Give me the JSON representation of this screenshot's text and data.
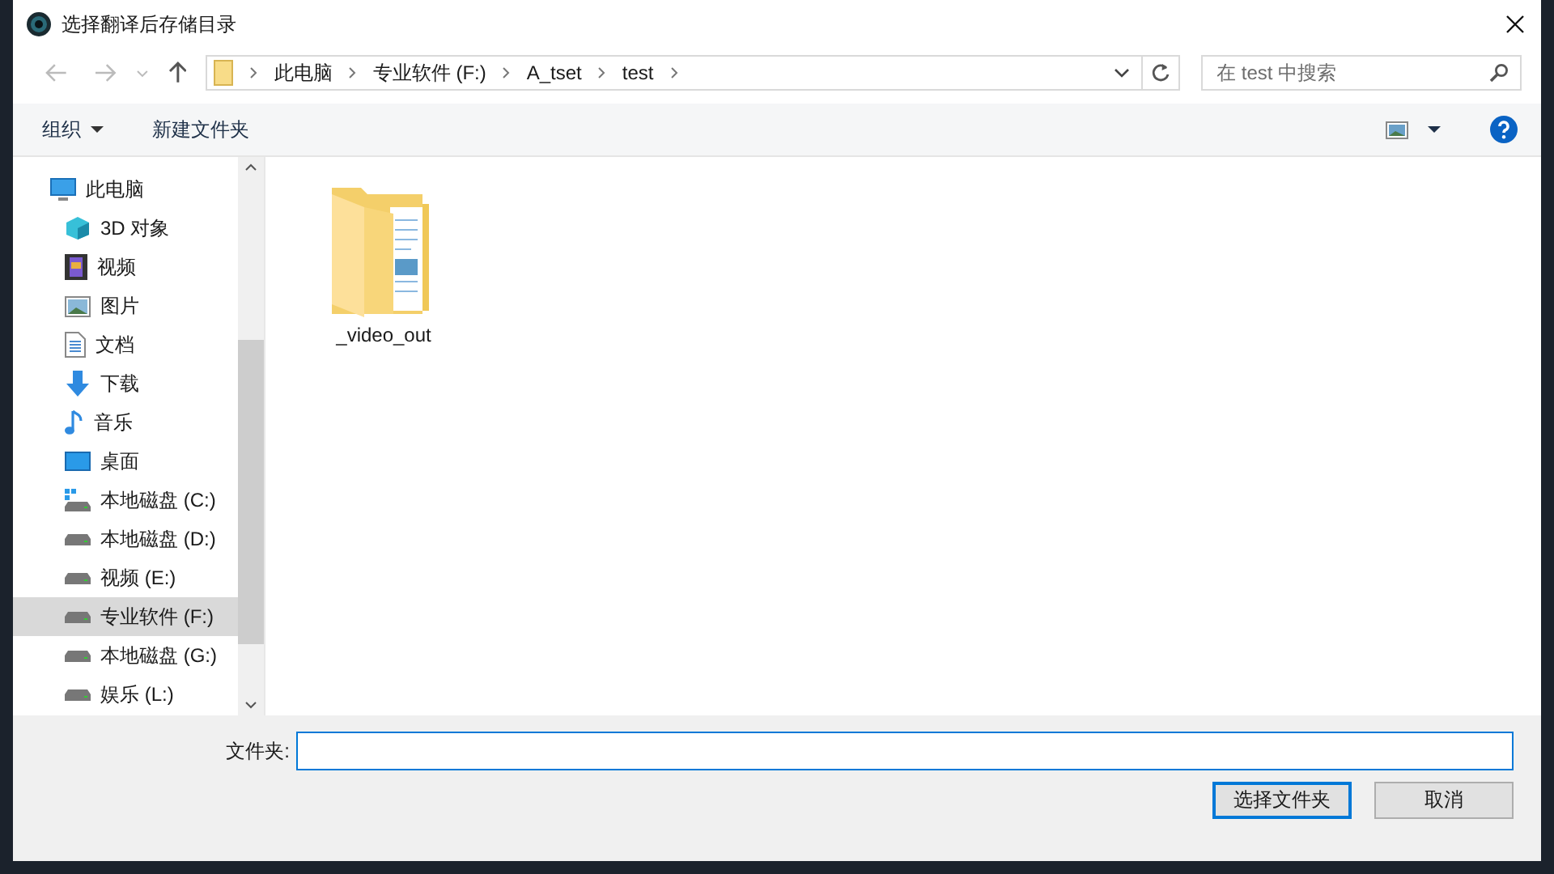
{
  "window": {
    "title": "选择翻译后存储目录"
  },
  "address_bar": {
    "crumbs": [
      "此电脑",
      "专业软件 (F:)",
      "A_tset",
      "test"
    ]
  },
  "search": {
    "placeholder": "在 test 中搜索"
  },
  "toolbar": {
    "organize": "组织",
    "new_folder": "新建文件夹"
  },
  "sidebar": {
    "items": [
      {
        "label": "此电脑",
        "kind": "pc",
        "selected": false,
        "children": [
          {
            "label": "3D 对象",
            "kind": "cube",
            "selected": false
          },
          {
            "label": "视频",
            "kind": "film",
            "selected": false
          },
          {
            "label": "图片",
            "kind": "picture",
            "selected": false
          },
          {
            "label": "文档",
            "kind": "document",
            "selected": false
          },
          {
            "label": "下载",
            "kind": "download",
            "selected": false
          },
          {
            "label": "音乐",
            "kind": "music",
            "selected": false
          },
          {
            "label": "桌面",
            "kind": "desktop",
            "selected": false
          },
          {
            "label": "本地磁盘 (C:)",
            "kind": "system-drive",
            "selected": false
          },
          {
            "label": "本地磁盘 (D:)",
            "kind": "drive",
            "selected": false
          },
          {
            "label": "视频 (E:)",
            "kind": "drive",
            "selected": false
          },
          {
            "label": "专业软件 (F:)",
            "kind": "drive",
            "selected": true
          },
          {
            "label": "本地磁盘 (G:)",
            "kind": "drive",
            "selected": false
          },
          {
            "label": "娱乐 (L:)",
            "kind": "drive",
            "selected": false
          }
        ]
      }
    ]
  },
  "files": [
    {
      "name": "_video_out",
      "kind": "folder"
    }
  ],
  "folder_field": {
    "label": "文件夹:"
  },
  "buttons": [
    "选择文件夹",
    "取消"
  ]
}
